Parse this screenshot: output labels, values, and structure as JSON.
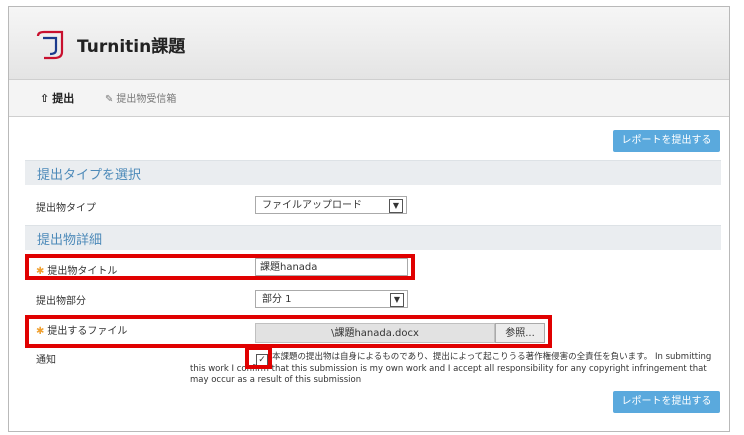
{
  "header": {
    "title": "Turnitin課題"
  },
  "tabs": [
    {
      "label": "提出",
      "icon": "upload-icon"
    },
    {
      "label": "提出物受信箱",
      "icon": "inbox-icon"
    }
  ],
  "top_button": "レポートを提出する",
  "section_type": {
    "title": "提出タイプを選択"
  },
  "type_row": {
    "label": "提出物タイプ",
    "value": "ファイルアップロード"
  },
  "section_detail": {
    "title": "提出物詳細"
  },
  "title_row": {
    "label": "提出物タイトル",
    "value": "課題hanada"
  },
  "part_row": {
    "label": "提出物部分",
    "value": "部分 1"
  },
  "file_row": {
    "label": "提出するファイル",
    "file": "\\課題hanada.docx",
    "browse": "参照..."
  },
  "notify": {
    "label": "通知",
    "text_line1": "本課題の提出物は自身によるものであり、提出によって起こりうる著作権侵害の全責任を負います。 In submitting",
    "text_line2": "this work I confirm that this submission is my own work and I accept all responsibility for any copyright infringement that may occur as a result of this submission"
  },
  "bottom_button": "レポートを提出する",
  "colors": {
    "accent": "#5aa9dd",
    "highlight": "#e00000",
    "section_title": "#4d8ab9"
  }
}
